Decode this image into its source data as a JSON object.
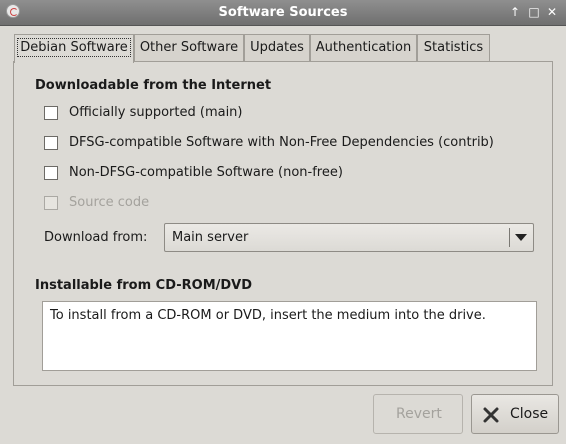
{
  "window": {
    "title": "Software Sources",
    "controls": {
      "up": "↑",
      "maximize": "□",
      "close": "✕"
    }
  },
  "tabs": [
    {
      "label": "Debian Software",
      "active": true
    },
    {
      "label": "Other Software",
      "active": false
    },
    {
      "label": "Updates",
      "active": false
    },
    {
      "label": "Authentication",
      "active": false
    },
    {
      "label": "Statistics",
      "active": false
    }
  ],
  "downloadable": {
    "title": "Downloadable from the Internet",
    "options": [
      {
        "label": "Officially supported (main)",
        "checked": false,
        "enabled": true
      },
      {
        "label": "DFSG-compatible Software with Non-Free Dependencies (contrib)",
        "checked": false,
        "enabled": true
      },
      {
        "label": "Non-DFSG-compatible Software (non-free)",
        "checked": false,
        "enabled": true
      },
      {
        "label": "Source code",
        "checked": false,
        "enabled": false
      }
    ],
    "download_from_label": "Download from:",
    "download_from_value": "Main server"
  },
  "cdrom": {
    "title": "Installable from CD-ROM/DVD",
    "message": "To install from a CD-ROM or DVD, insert the medium into the drive."
  },
  "buttons": {
    "revert": "Revert",
    "close": "Close"
  },
  "icons": {
    "app": "software-sources-icon",
    "close": "close-x-icon",
    "cursor": "mouse-pointer-icon"
  }
}
